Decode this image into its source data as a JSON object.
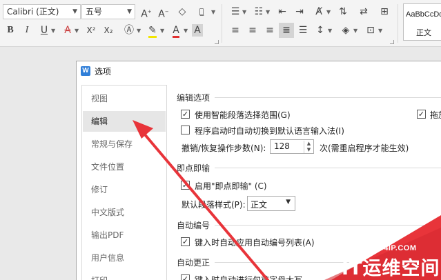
{
  "ribbon": {
    "font_name": "Calibri (正文)",
    "font_size": "五号",
    "style_gallery": {
      "preview": "AaBbCcDd",
      "name": "正文"
    }
  },
  "dialog": {
    "title": "选项",
    "app_icon_letter": "W",
    "nav": [
      {
        "label": "视图",
        "active": false
      },
      {
        "label": "编辑",
        "active": true
      },
      {
        "label": "常规与保存",
        "active": false
      },
      {
        "label": "文件位置",
        "active": false
      },
      {
        "label": "修订",
        "active": false
      },
      {
        "label": "中文版式",
        "active": false
      },
      {
        "label": "输出PDF",
        "active": false
      },
      {
        "label": "用户信息",
        "active": false
      },
      {
        "label": "打印",
        "active": false
      }
    ],
    "sections": {
      "edit": {
        "title": "编辑选项",
        "smart_select": {
          "label": "使用智能段落选择范围(G)",
          "checked": true
        },
        "drag_truncated": {
          "label": "拖放",
          "checked": true
        },
        "auto_ime": {
          "label": "程序启动时自动切换到默认语言输入法(I)",
          "checked": false
        },
        "undo_label": "撤销/恢复操作步数(N):",
        "undo_value": "128",
        "undo_note": "次(需重启程序才能生效)"
      },
      "click_type": {
        "title": "即点即输",
        "enable": {
          "label": "启用\"即点即输\" (C)",
          "checked": true
        },
        "style_label": "默认段落样式(P):",
        "style_value": "正文"
      },
      "auto_number": {
        "title": "自动编号",
        "apply_list": {
          "label": "键入时自动应用自动编号列表(A)",
          "checked": true
        }
      },
      "auto_correct": {
        "title": "自动更正",
        "first_item": {
          "label": "键入时自动进行句首字母大写",
          "checked": true
        }
      }
    }
  },
  "watermark": {
    "url": "WWW.94IP.COM",
    "name": "IT运维空间"
  },
  "colors": {
    "accent_red": "#e8343a",
    "nav_active_bg": "#e6e6e6",
    "app_icon_blue": "#2f7ed8"
  }
}
